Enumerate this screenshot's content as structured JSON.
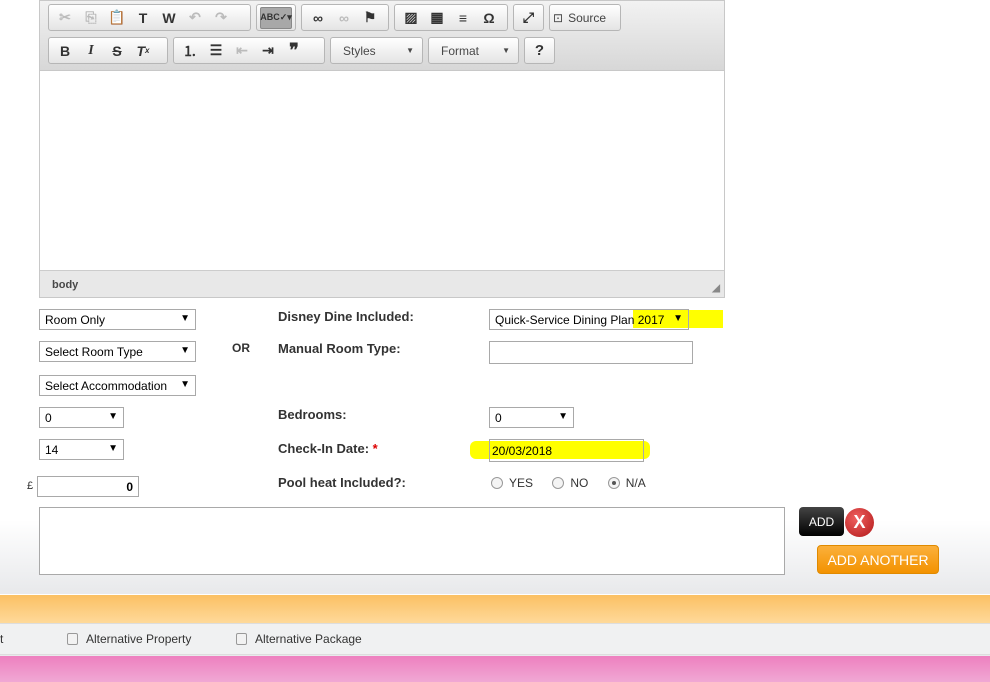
{
  "editor": {
    "toolbar": {
      "source_label": "Source",
      "styles_label": "Styles",
      "format_label": "Format",
      "help_label": "?"
    },
    "path": "body"
  },
  "form": {
    "board_select": "Room Only",
    "room_type_select": "Select Room Type",
    "accommodation_select": "Select Accommodation",
    "num_select_a": "0",
    "num_select_b": "14",
    "currency": "£",
    "price": "0",
    "or_label": "OR",
    "disney_dine_label": "Disney Dine Included:",
    "disney_dine_value": "Quick-Service Dining Plan 2017",
    "manual_room_label": "Manual Room Type:",
    "manual_room_value": "",
    "bedrooms_label": "Bedrooms:",
    "bedrooms_value": "0",
    "checkin_label": "Check-In Date:",
    "required_mark": "*",
    "checkin_value": "20/03/2018",
    "pool_label": "Pool heat Included?:",
    "pool_options": [
      "YES",
      "NO",
      "N/A"
    ],
    "pool_selected": "N/A"
  },
  "buttons": {
    "add": "ADD",
    "add_another": "ADD ANOTHER",
    "remove": "X"
  },
  "options": {
    "partial": "t",
    "alt_property": "Alternative Property",
    "alt_package": "Alternative Package"
  },
  "colors": {
    "highlight": "#ffff00",
    "orange": "#f7a21c",
    "pink": "#ee86c1"
  }
}
